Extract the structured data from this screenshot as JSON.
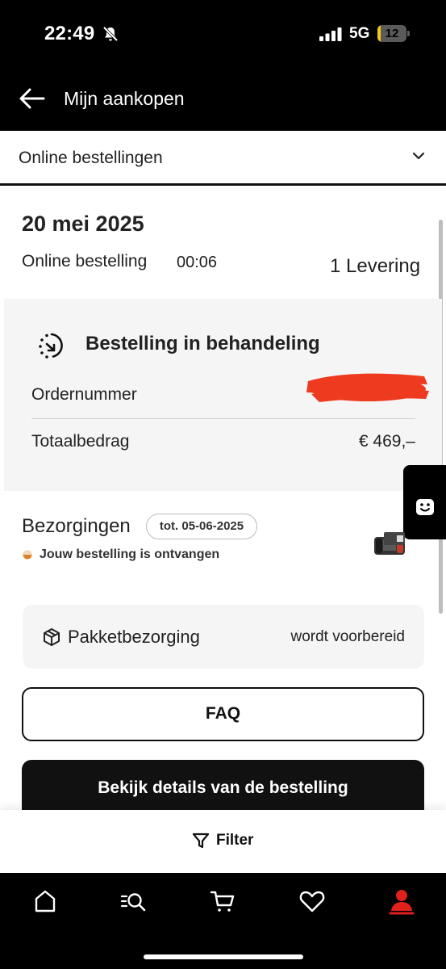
{
  "status_bar": {
    "time": "22:49",
    "network": "5G",
    "battery_level": "12",
    "battery_fraction": 0.12
  },
  "header": {
    "title": "Mijn aankopen",
    "back_icon": "back-arrow-icon"
  },
  "order_type_select": {
    "selected": "Online bestellingen",
    "icon": "chevron-down-icon"
  },
  "order": {
    "date": "20 mei 2025",
    "kind": "Online bestelling",
    "time": "00:06",
    "delivery_count": "1 Levering",
    "status_title": "Bestelling in behandeling",
    "ordernumber_label": "Ordernummer",
    "total_label": "Totaalbedrag",
    "total_value": "€ 469,–"
  },
  "deliveries": {
    "title": "Bezorgingen",
    "date_badge": "tot. 05-06-2025",
    "received_text": "Jouw bestelling is ontvangen",
    "parcel_label": "Pakketbezorging",
    "parcel_status": "wordt voorbereid"
  },
  "buttons": {
    "faq": "FAQ",
    "details": "Bekijk details van de bestelling",
    "filter": "Filter"
  },
  "colors": {
    "black": "#000000",
    "card_background": "#f5f5f5",
    "battery_yellow": "#f0c91a",
    "redaction_red": "#ee3a1e",
    "status_orange": "#d9822b",
    "profile_red": "#e0201a"
  },
  "bottom_nav": [
    {
      "icon": "home-icon"
    },
    {
      "icon": "search-icon"
    },
    {
      "icon": "cart-icon"
    },
    {
      "icon": "heart-icon"
    },
    {
      "icon": "profile-icon",
      "active": true
    }
  ]
}
